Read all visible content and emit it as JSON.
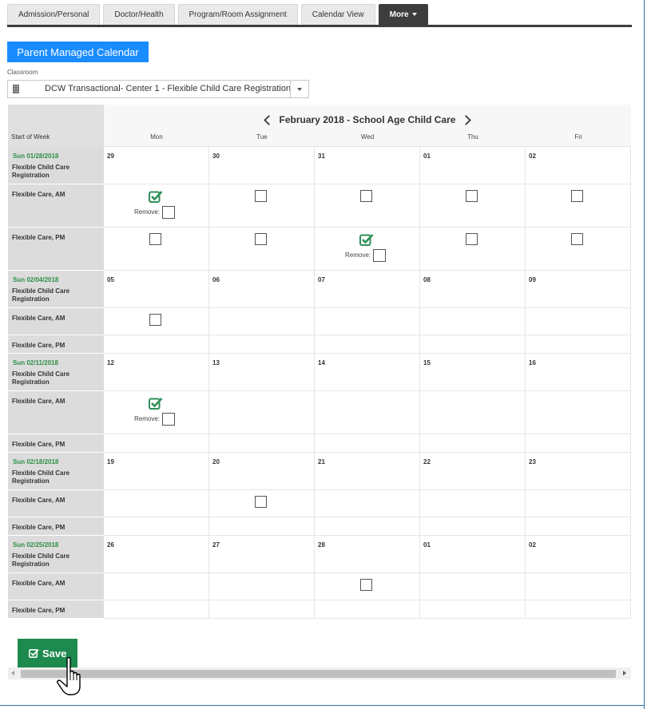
{
  "tabs": [
    {
      "label": "Admission/Personal"
    },
    {
      "label": "Doctor/Health"
    },
    {
      "label": "Program/Room Assignment"
    },
    {
      "label": "Calendar View"
    },
    {
      "label": "More"
    }
  ],
  "parent_calendar_button": "Parent Managed Calendar",
  "classroom": {
    "label": "Classroom",
    "value": "DCW Transactional- Center 1 - Flexible Child Care Registration"
  },
  "calendar": {
    "title": "February 2018 - School Age Child Care",
    "left_header": "Start of Week",
    "days": [
      "Mon",
      "Tue",
      "Wed",
      "Thu",
      "Fri"
    ],
    "remove_label": "Remove:",
    "weeks": [
      {
        "start": "Sun 01/28/2018",
        "registration": "Flexible Child Care Registration",
        "dates": [
          "29",
          "30",
          "31",
          "01",
          "02"
        ],
        "sessions": [
          {
            "label": "Flexible Care, AM",
            "cells": [
              "checked",
              "open",
              "open",
              "open",
              "open"
            ]
          },
          {
            "label": "Flexible Care, PM",
            "cells": [
              "open",
              "open",
              "checked",
              "open",
              "open"
            ]
          }
        ]
      },
      {
        "start": "Sun 02/04/2018",
        "registration": "Flexible Child Care Registration",
        "dates": [
          "05",
          "06",
          "07",
          "08",
          "09"
        ],
        "sessions": [
          {
            "label": "Flexible Care, AM",
            "cells": [
              "open",
              "none",
              "none",
              "none",
              "none"
            ]
          },
          {
            "label": "Flexible Care, PM",
            "cells": [
              "none",
              "none",
              "none",
              "none",
              "none"
            ]
          }
        ]
      },
      {
        "start": "Sun 02/11/2018",
        "registration": "Flexible Child Care Registration",
        "dates": [
          "12",
          "13",
          "14",
          "15",
          "16"
        ],
        "sessions": [
          {
            "label": "Flexible Care, AM",
            "cells": [
              "checked",
              "none",
              "none",
              "none",
              "none"
            ]
          },
          {
            "label": "Flexible Care, PM",
            "cells": [
              "none",
              "none",
              "none",
              "none",
              "none"
            ]
          }
        ]
      },
      {
        "start": "Sun 02/18/2018",
        "registration": "Flexible Child Care Registration",
        "dates": [
          "19",
          "20",
          "21",
          "22",
          "23"
        ],
        "sessions": [
          {
            "label": "Flexible Care, AM",
            "cells": [
              "none",
              "open",
              "none",
              "none",
              "none"
            ]
          },
          {
            "label": "Flexible Care, PM",
            "cells": [
              "none",
              "none",
              "none",
              "none",
              "none"
            ]
          }
        ]
      },
      {
        "start": "Sun 02/25/2018",
        "registration": "Flexible Child Care Registration",
        "dates": [
          "26",
          "27",
          "28",
          "01",
          "02"
        ],
        "sessions": [
          {
            "label": "Flexible Care, AM",
            "cells": [
              "none",
              "none",
              "open",
              "none",
              "none"
            ]
          },
          {
            "label": "Flexible Care, PM",
            "cells": [
              "none",
              "none",
              "none",
              "none",
              "none"
            ]
          }
        ]
      }
    ]
  },
  "save_button": "Save",
  "colors": {
    "primary_blue": "#1a8cff",
    "save_green": "#1e8a4e",
    "date_green": "#2f8f47",
    "dark_tab": "#3d3d3d"
  }
}
